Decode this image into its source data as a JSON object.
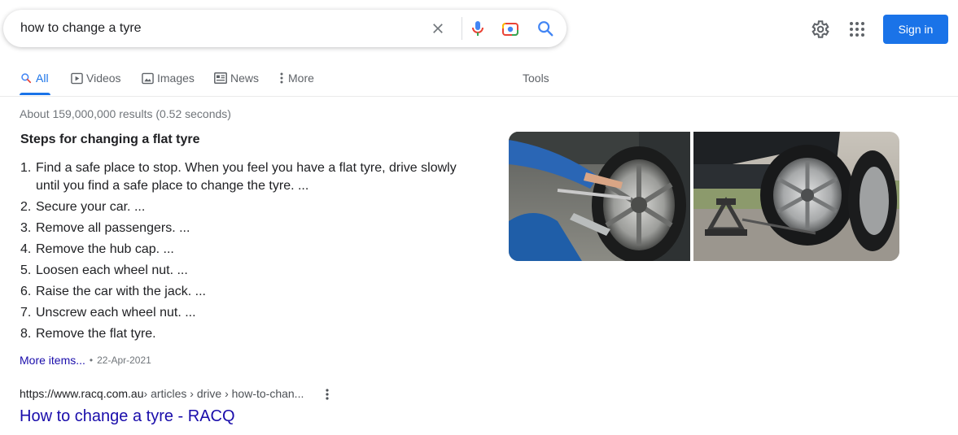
{
  "search": {
    "query": "how to change a tyre"
  },
  "header": {
    "sign_in_label": "Sign in",
    "accent_color": "#1a73e8"
  },
  "tabs": [
    {
      "label": "All",
      "icon": "search-icon",
      "active": true
    },
    {
      "label": "Videos",
      "icon": "video-icon"
    },
    {
      "label": "Images",
      "icon": "image-icon"
    },
    {
      "label": "News",
      "icon": "news-icon"
    },
    {
      "label": "More",
      "icon": "more-vert-icon"
    }
  ],
  "tools_label": "Tools",
  "result_stats": "About 159,000,000 results (0.52 seconds)",
  "featured_snippet": {
    "title": "Steps for changing a flat tyre",
    "steps": [
      {
        "num": "1.",
        "text": "Find a safe place to stop. When you feel you have a flat tyre, drive slowly until you find a safe place to change the tyre. ..."
      },
      {
        "num": "2.",
        "text": "Secure your car. ..."
      },
      {
        "num": "3.",
        "text": "Remove all passengers. ..."
      },
      {
        "num": "4.",
        "text": "Remove the hub cap. ..."
      },
      {
        "num": "5.",
        "text": "Loosen each wheel nut. ..."
      },
      {
        "num": "6.",
        "text": "Raise the car with the jack. ..."
      },
      {
        "num": "7.",
        "text": "Unscrew each wheel nut. ..."
      },
      {
        "num": "8.",
        "text": "Remove the flat tyre."
      }
    ],
    "more_items_label": "More items...",
    "separator": "•",
    "date": "22-Apr-2021"
  },
  "result": {
    "domain": "https://www.racq.com.au",
    "path": " › articles › drive › how-to-chan...",
    "title": "How to change a tyre - RACQ"
  }
}
